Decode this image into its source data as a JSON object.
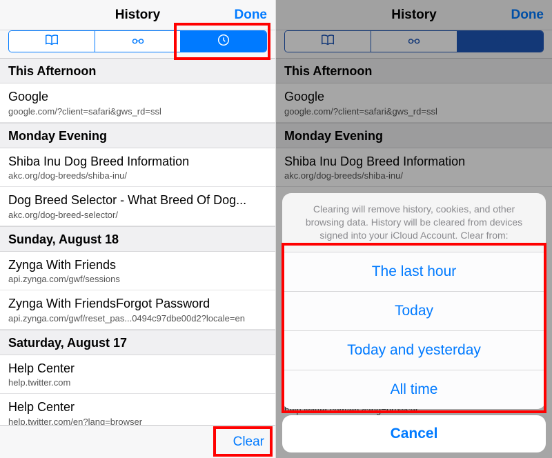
{
  "left": {
    "header": {
      "title": "History",
      "done": "Done"
    },
    "tabs": {
      "bookmarks_icon": "book-open-icon",
      "readinglist_icon": "glasses-icon",
      "history_icon": "clock-icon",
      "active": "history"
    },
    "sections": [
      {
        "label": "This Afternoon",
        "rows": [
          {
            "title": "Google",
            "sub": "google.com/?client=safari&gws_rd=ssl"
          }
        ]
      },
      {
        "label": "Monday Evening",
        "rows": [
          {
            "title": "Shiba Inu Dog Breed Information",
            "sub": "akc.org/dog-breeds/shiba-inu/"
          },
          {
            "title": "Dog Breed Selector - What Breed Of Dog...",
            "sub": "akc.org/dog-breed-selector/"
          }
        ]
      },
      {
        "label": "Sunday, August 18",
        "rows": [
          {
            "title": "Zynga With Friends",
            "sub": "api.zynga.com/gwf/sessions"
          },
          {
            "title": "Zynga With FriendsForgot Password",
            "sub": "api.zynga.com/gwf/reset_pas...0494c97dbe00d2?locale=en"
          }
        ]
      },
      {
        "label": "Saturday, August 17",
        "rows": [
          {
            "title": "Help Center",
            "sub": "help.twitter.com"
          },
          {
            "title": "Help Center",
            "sub": "help.twitter.com/en?lang=browser"
          }
        ]
      }
    ],
    "footer": {
      "clear": "Clear"
    }
  },
  "right": {
    "header": {
      "title": "History",
      "done": "Done"
    },
    "sections_visible": [
      {
        "label": "This Afternoon",
        "rows": [
          {
            "title": "Google",
            "sub": "google.com/?client=safari&gws_rd=ssl"
          }
        ]
      },
      {
        "label": "Monday Evening",
        "rows": [
          {
            "title": "Shiba Inu Dog Breed Information",
            "sub": "akc.org/dog-breeds/shiba-inu/"
          }
        ]
      }
    ],
    "peek_sub": "help.twitter.com/en?lang=browser",
    "actionsheet": {
      "message": "Clearing will remove history, cookies, and other browsing data. History will be cleared from devices signed into your iCloud Account. Clear from:",
      "options": [
        "The last hour",
        "Today",
        "Today and yesterday",
        "All time"
      ],
      "cancel": "Cancel"
    }
  }
}
